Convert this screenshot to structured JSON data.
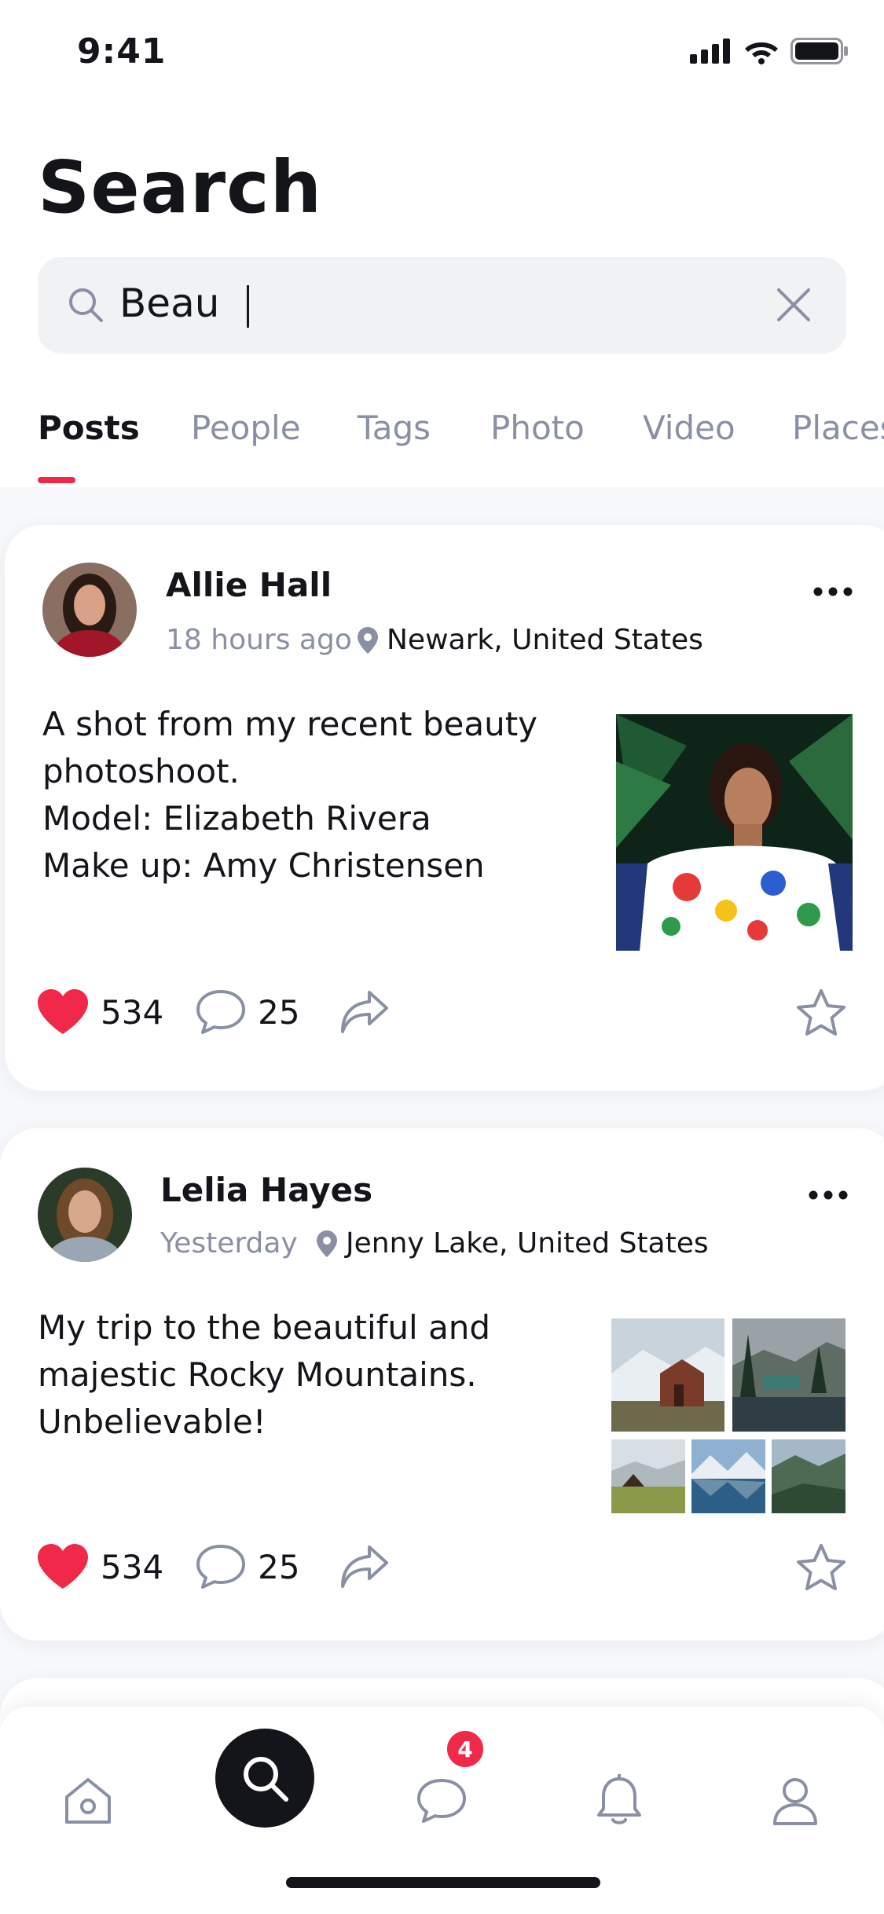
{
  "status_bar": {
    "time": "9:41"
  },
  "header": {
    "title": "Search"
  },
  "search": {
    "value": "Beau"
  },
  "tabs": [
    {
      "label": "Posts",
      "active": true
    },
    {
      "label": "People",
      "active": false
    },
    {
      "label": "Tags",
      "active": false
    },
    {
      "label": "Photo",
      "active": false
    },
    {
      "label": "Video",
      "active": false
    },
    {
      "label": "Places",
      "active": false
    }
  ],
  "posts": [
    {
      "author": "Allie Hall",
      "time": "18 hours ago",
      "location": "Newark, United States",
      "text_lines": [
        "A shot from my recent beauty",
        "photoshoot.",
        "Model: Elizabeth Rivera",
        "Make up: Amy Christensen"
      ],
      "likes": "534",
      "comments": "25"
    },
    {
      "author": "Lelia Hayes",
      "time": "Yesterday",
      "location": "Jenny Lake, United States",
      "text_lines": [
        "My trip to the beautiful and",
        "majestic Rocky Mountains.",
        "Unbelievable!"
      ],
      "likes": "534",
      "comments": "25"
    }
  ],
  "tabbar": {
    "items": [
      "home-icon",
      "search-icon",
      "chat-icon",
      "bell-icon",
      "profile-icon"
    ],
    "messages_badge": "4"
  },
  "colors": {
    "accent": "#f0284a",
    "text": "#14151a",
    "muted": "#8a90a3",
    "search_bg": "#f1f2f4"
  }
}
